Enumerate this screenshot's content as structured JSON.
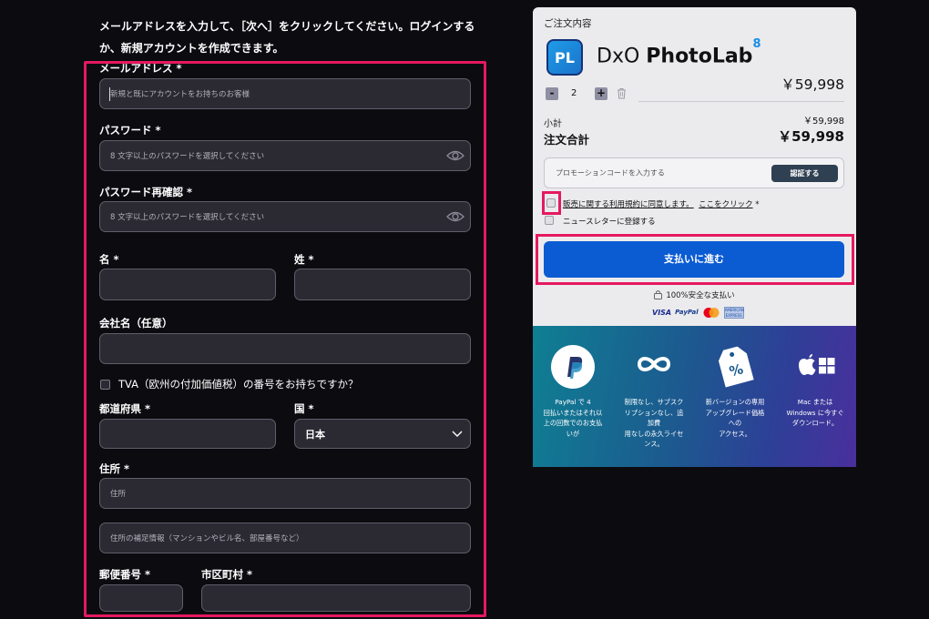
{
  "intro_text": "メールアドレスを入力して、［次へ］をクリックしてください。ログインするか、新規アカウントを作成できます。",
  "form": {
    "email": {
      "label": "メールアドレス *",
      "placeholder": "新規と既にアカウントをお持ちのお客様"
    },
    "password": {
      "label": "パスワード *",
      "placeholder": "8 文字以上のパスワードを選択してください"
    },
    "password_confirm": {
      "label": "パスワード再確認 *",
      "placeholder": "8 文字以上のパスワードを選択してください"
    },
    "first_name": {
      "label": "名 *"
    },
    "last_name": {
      "label": "姓 *"
    },
    "company": {
      "label": "会社名（任意）"
    },
    "tva": {
      "label": "TVA（欧州の付加価値税）の番号をお持ちですか？"
    },
    "prefecture": {
      "label": "都道府県 *"
    },
    "country": {
      "label": "国 *",
      "value": "日本"
    },
    "address": {
      "label": "住所 *",
      "placeholder": "住所"
    },
    "address2": {
      "placeholder": "住所の補足情報（マンションやビル名、部屋番号など）"
    },
    "postal": {
      "label": "郵便番号 *"
    },
    "city": {
      "label": "市区町村 *"
    }
  },
  "order": {
    "title": "ご注文内容",
    "logo_text": "PL",
    "product_brand": "DxO",
    "product_name": "PhotoLab",
    "product_version": "8",
    "price": "￥59,998",
    "qty_minus": "-",
    "qty_value": "2",
    "qty_plus": "+",
    "subtotal_label": "小計",
    "subtotal_value": "￥59,998",
    "total_label": "注文合計",
    "total_value": "￥59,998",
    "promo_placeholder": "プロモーションコードを入力する",
    "promo_button": "認証する",
    "terms_text": "販売に関する利用規約に同意します。",
    "terms_link": "ここをクリック",
    "terms_required": " *",
    "newsletter_text": "ニュースレターに登録する",
    "pay_button": "支払いに進む",
    "secure_text": "100%安全な支払い",
    "card_visa": "VISA",
    "card_paypal": "PayPal",
    "card_amex": "AMERICAN EXPRESS"
  },
  "banner": [
    {
      "icon": "paypal-icon",
      "text": "PayPal で 4\n回払いまたはそれ以\n上の回数でのお支払\nいが"
    },
    {
      "icon": "infinity-icon",
      "text": "制限なし、サブスク\nリプションなし、追\n加費\n用なしの永久ライセ\nンス。"
    },
    {
      "icon": "discount-tag-icon",
      "text": "新バージョンの専用\nアップグレード価格\nへの\nアクセス。"
    },
    {
      "icon": "apple-windows-icon",
      "text": "Mac または\nWindows に今すぐ\nダウンロード。"
    }
  ],
  "colors": {
    "highlight": "#e5195f",
    "pay_button": "#0b5bd3",
    "page_bg": "#0c0b10",
    "field_bg": "#2b2a33"
  }
}
